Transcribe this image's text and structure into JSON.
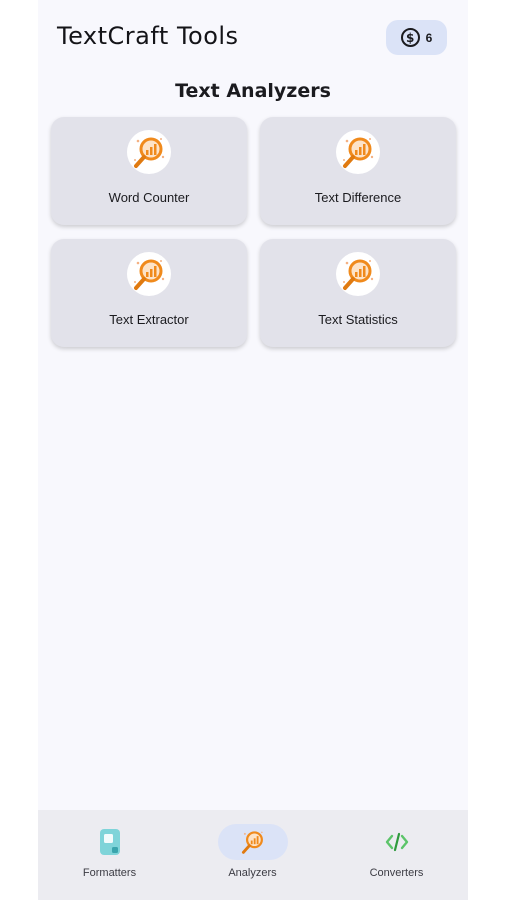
{
  "header": {
    "title": "TextCraft Tools",
    "coins": {
      "icon": "dollar-coin-icon",
      "count": "6"
    }
  },
  "section": {
    "title": "Text Analyzers"
  },
  "tools": [
    {
      "label": "Word Counter",
      "icon": "magnifier-chart-icon"
    },
    {
      "label": "Text Difference",
      "icon": "magnifier-chart-icon"
    },
    {
      "label": "Text Extractor",
      "icon": "magnifier-chart-icon"
    },
    {
      "label": "Text Statistics",
      "icon": "magnifier-chart-icon"
    }
  ],
  "bottom_nav": {
    "items": [
      {
        "label": "Formatters",
        "icon": "document-icon",
        "active": false
      },
      {
        "label": "Analyzers",
        "icon": "magnifier-chart-icon",
        "active": true
      },
      {
        "label": "Converters",
        "icon": "code-icon",
        "active": false
      }
    ]
  },
  "colors": {
    "background": "#f8f8fd",
    "card": "#e2e2ea",
    "badge": "#dbe3f7",
    "accent_orange": "#f08a1c",
    "nav_bg": "#ececf1"
  }
}
